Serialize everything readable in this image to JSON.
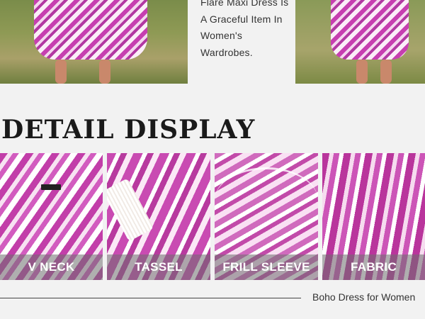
{
  "top": {
    "description": "Flare Maxi Dress Is A Graceful Item In Women's Wardrobes."
  },
  "section": {
    "heading": "DETAIL DISPLAY"
  },
  "details": [
    {
      "label": "V NECK"
    },
    {
      "label": "TASSEL"
    },
    {
      "label": "FRILL SLEEVE"
    },
    {
      "label": "FABRIC"
    }
  ],
  "footer": {
    "text": "Boho Dress for Women"
  },
  "colors": {
    "print_magenta": "#c63fb0",
    "label_overlay": "#6e6e6e",
    "background": "#f2f2f2"
  }
}
